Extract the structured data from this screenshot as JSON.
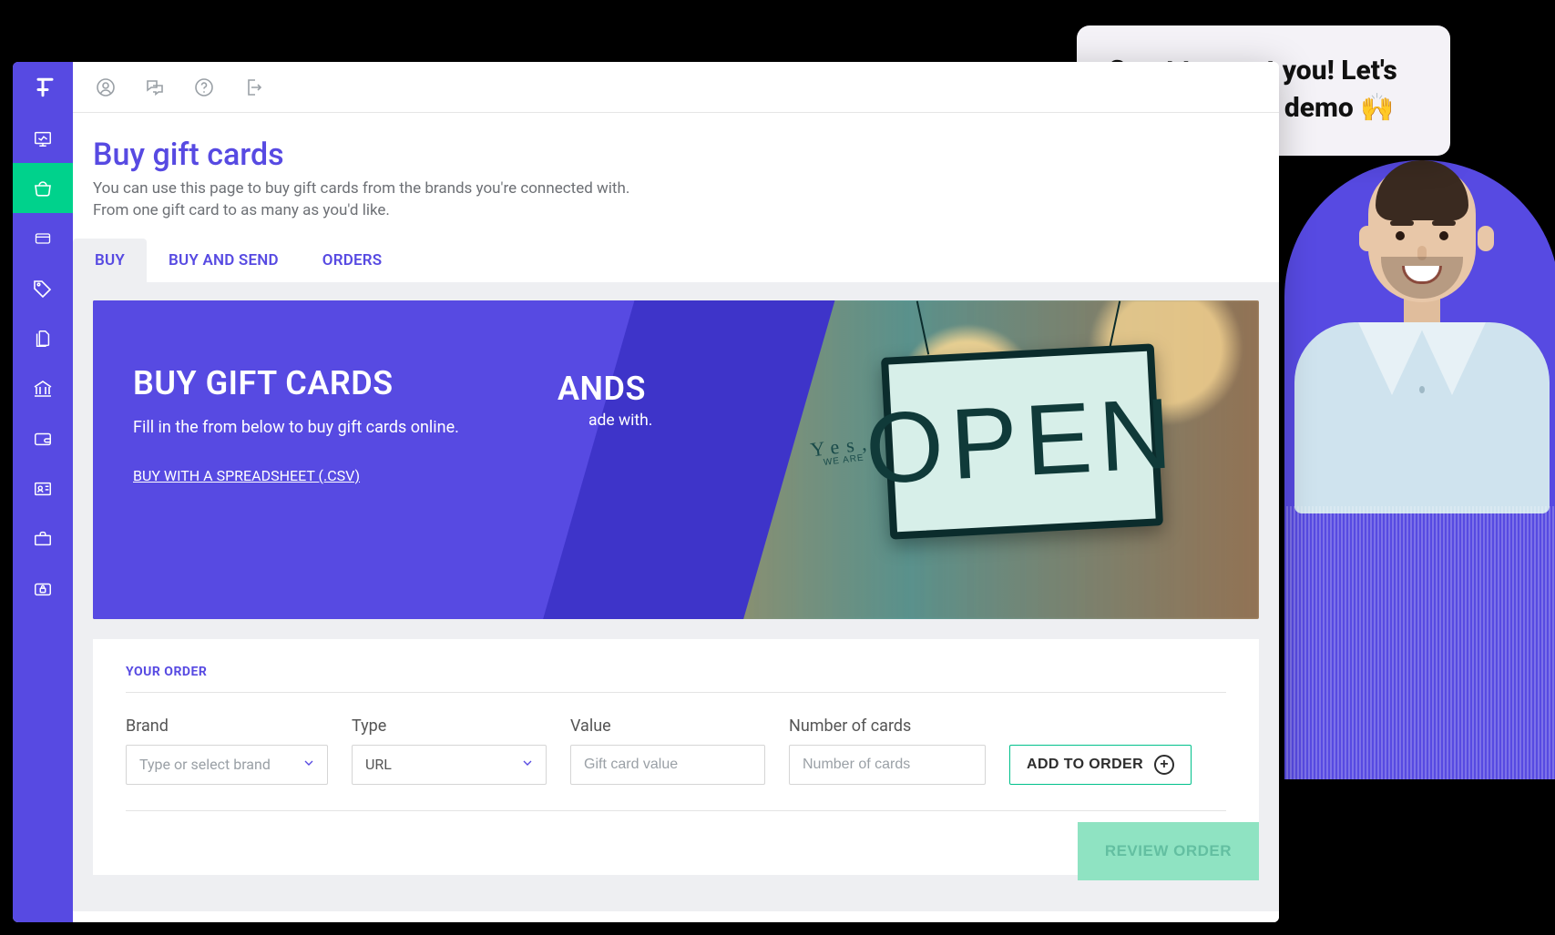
{
  "page": {
    "title": "Buy gift cards",
    "subtitle": "You can use this page to buy gift cards from the brands you're connected with. From one gift card to as many as you'd like."
  },
  "tabs": [
    {
      "label": "BUY",
      "active": true
    },
    {
      "label": "BUY AND SEND",
      "active": false
    },
    {
      "label": "ORDERS",
      "active": false
    }
  ],
  "hero": {
    "title": "BUY GIFT CARDS",
    "desc": "Fill in the from below to buy gift cards online.",
    "link": "BUY WITH A SPREADSHEET (.CSV)",
    "brands_title_fragment": "ANDS",
    "brands_desc_fragment": "ade with.",
    "sign_yes": "Yes,",
    "sign_weare": "WE ARE",
    "sign_open": "OPEN"
  },
  "order": {
    "heading": "YOUR ORDER",
    "fields": {
      "brand": {
        "label": "Brand",
        "placeholder": "Type or select brand"
      },
      "type": {
        "label": "Type",
        "value": "URL"
      },
      "value": {
        "label": "Value",
        "placeholder": "Gift card value"
      },
      "count": {
        "label": "Number of cards",
        "placeholder": "Number of cards"
      }
    },
    "add_button": "ADD TO ORDER",
    "review_button": "REVIEW ORDER"
  },
  "demo": {
    "text": "Great to meet you! Let's start your live demo 🙌"
  }
}
